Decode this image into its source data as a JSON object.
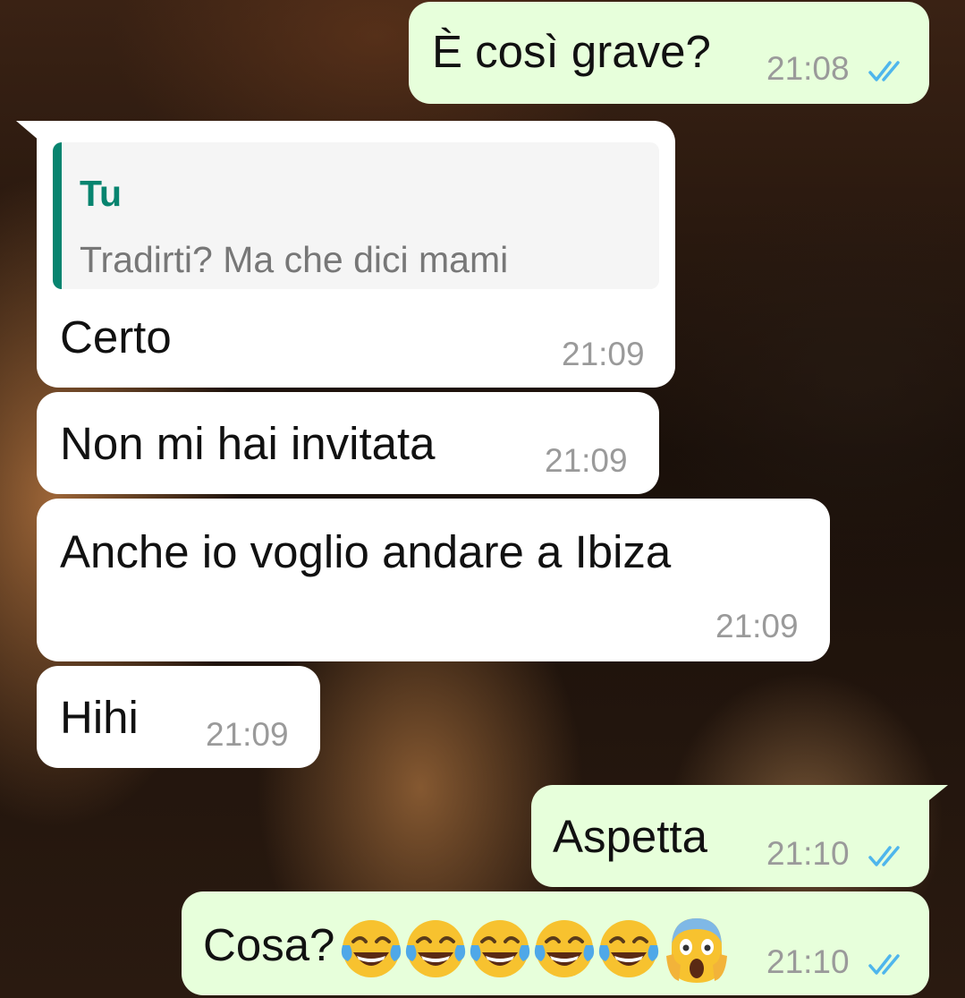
{
  "messages": [
    {
      "direction": "outgoing",
      "text": "È così grave?",
      "time": "21:08",
      "status": "read"
    },
    {
      "direction": "incoming",
      "quoted": {
        "author": "Tu",
        "text": "Tradirti? Ma che dici mami"
      },
      "text": "Certo",
      "time": "21:09"
    },
    {
      "direction": "incoming",
      "text": "Non mi hai invitata",
      "time": "21:09"
    },
    {
      "direction": "incoming",
      "text": "Anche io voglio andare a Ibiza",
      "time": "21:09"
    },
    {
      "direction": "incoming",
      "text": "Hihi",
      "time": "21:09"
    },
    {
      "direction": "outgoing",
      "text": "Aspetta",
      "time": "21:10",
      "status": "read"
    },
    {
      "direction": "outgoing",
      "text": "Cosa?",
      "emojis": [
        "face-with-tears-of-joy",
        "face-with-tears-of-joy",
        "face-with-tears-of-joy",
        "face-with-tears-of-joy",
        "face-with-tears-of-joy",
        "face-screaming-in-fear"
      ],
      "time": "21:10",
      "status": "read"
    }
  ],
  "colors": {
    "incoming_bubble": "#ffffff",
    "outgoing_bubble": "#e7ffdb",
    "read_ticks": "#4fb6ec",
    "quote_accent": "#07846f",
    "timestamp": "#9a9a9a"
  },
  "icons": {
    "read_receipt": "double-check-icon"
  }
}
